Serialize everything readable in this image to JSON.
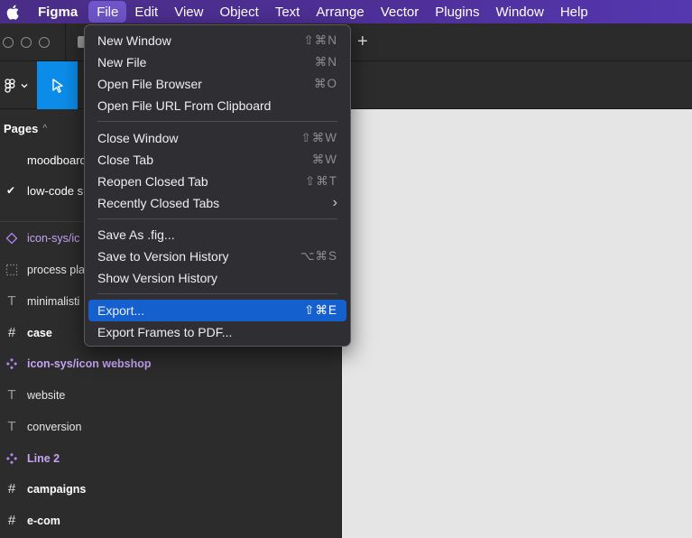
{
  "menubar": {
    "apple_icon": "apple-icon",
    "app_name": "Figma",
    "items": [
      "File",
      "Edit",
      "View",
      "Object",
      "Text",
      "Arrange",
      "Vector",
      "Plugins",
      "Window",
      "Help"
    ],
    "open_menu": "File"
  },
  "tabbar": {
    "new_tab_label": "+"
  },
  "toolbar": {
    "main_menu_icon": "figma-logo-icon",
    "active_tool": "move-tool",
    "accent_color": "#0c8ce9"
  },
  "pages": {
    "title": "Pages",
    "items": [
      {
        "label": "moodboard",
        "checked": false
      },
      {
        "label": "low-code s",
        "checked": true
      }
    ]
  },
  "layers": [
    {
      "name": "icon-sys/ic",
      "type": "component-instance",
      "icon": "diamond-icon"
    },
    {
      "name": "process pla",
      "type": "section",
      "icon": "dotted-frame-icon"
    },
    {
      "name": "minimalisti",
      "type": "text",
      "icon": "text-icon"
    },
    {
      "name": "case",
      "type": "frame",
      "icon": "frame-icon"
    },
    {
      "name": "icon-sys/icon webshop",
      "type": "component",
      "icon": "component-icon"
    },
    {
      "name": "website",
      "type": "text",
      "icon": "text-icon"
    },
    {
      "name": "conversion",
      "type": "text",
      "icon": "text-icon"
    },
    {
      "name": "Line 2",
      "type": "component",
      "icon": "component-icon"
    },
    {
      "name": "campaigns",
      "type": "frame",
      "icon": "frame-icon"
    },
    {
      "name": "e-com",
      "type": "frame",
      "icon": "frame-icon"
    }
  ],
  "file_menu": {
    "groups": [
      [
        {
          "label": "New Window",
          "shortcut": "⇧⌘N"
        },
        {
          "label": "New File",
          "shortcut": "⌘N"
        },
        {
          "label": "Open File Browser",
          "shortcut": "⌘O"
        },
        {
          "label": "Open File URL From Clipboard",
          "shortcut": ""
        }
      ],
      [
        {
          "label": "Close Window",
          "shortcut": "⇧⌘W"
        },
        {
          "label": "Close Tab",
          "shortcut": "⌘W"
        },
        {
          "label": "Reopen Closed Tab",
          "shortcut": "⇧⌘T"
        },
        {
          "label": "Recently Closed Tabs",
          "shortcut": "",
          "submenu": true
        }
      ],
      [
        {
          "label": "Save As .fig...",
          "shortcut": ""
        },
        {
          "label": "Save to Version History",
          "shortcut": "⌥⌘S"
        },
        {
          "label": "Show Version History",
          "shortcut": ""
        }
      ],
      [
        {
          "label": "Export...",
          "shortcut": "⇧⌘E",
          "highlighted": true
        },
        {
          "label": "Export Frames to PDF...",
          "shortcut": ""
        }
      ]
    ],
    "highlight_color": "#1560cf"
  }
}
